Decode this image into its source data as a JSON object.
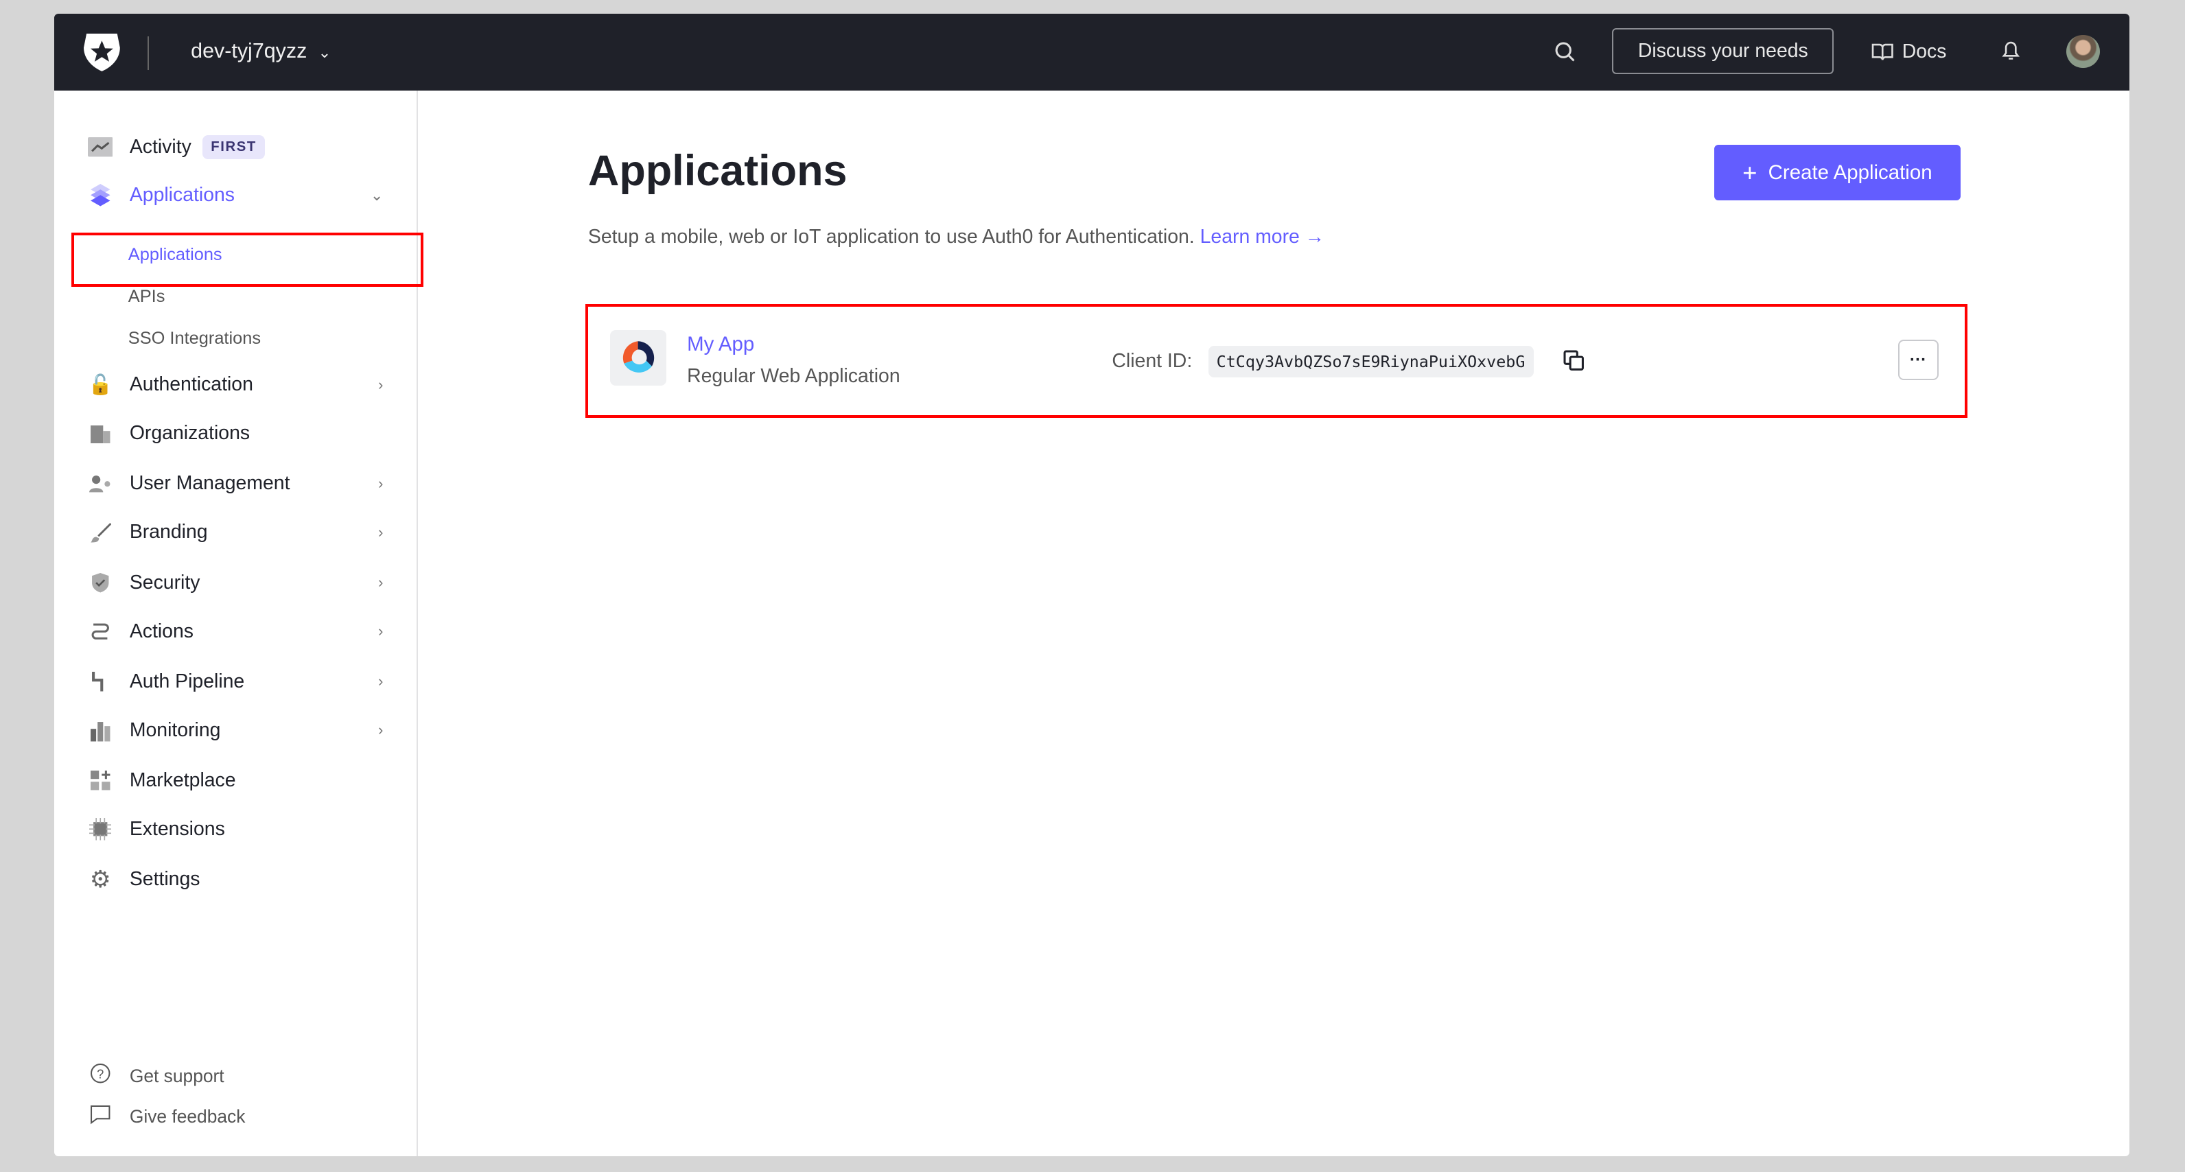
{
  "header": {
    "tenant": "dev-tyj7qyzz",
    "discuss": "Discuss your needs",
    "docs": "Docs"
  },
  "sidebar": {
    "items": [
      {
        "label": "Activity",
        "badge": "FIRST"
      },
      {
        "label": "Applications"
      },
      {
        "label": "Authentication"
      },
      {
        "label": "Organizations"
      },
      {
        "label": "User Management"
      },
      {
        "label": "Branding"
      },
      {
        "label": "Security"
      },
      {
        "label": "Actions"
      },
      {
        "label": "Auth Pipeline"
      },
      {
        "label": "Monitoring"
      },
      {
        "label": "Marketplace"
      },
      {
        "label": "Extensions"
      },
      {
        "label": "Settings"
      }
    ],
    "sub_items": [
      {
        "label": "Applications"
      },
      {
        "label": "APIs"
      },
      {
        "label": "SSO Integrations"
      }
    ],
    "footer": {
      "support": "Get support",
      "feedback": "Give feedback"
    }
  },
  "main": {
    "title": "Applications",
    "description": "Setup a mobile, web or IoT application to use Auth0 for Authentication.",
    "learn_more": "Learn more →",
    "create_button": "Create Application",
    "apps": [
      {
        "name": "My App",
        "type": "Regular Web Application",
        "client_id_label": "Client ID:",
        "client_id": "CtCqy3AvbQZSo7sE9RiynaPuiXOxvebG"
      }
    ]
  },
  "colors": {
    "accent": "#635dff",
    "header_bg": "#1f2129",
    "highlight": "#ff0000"
  }
}
